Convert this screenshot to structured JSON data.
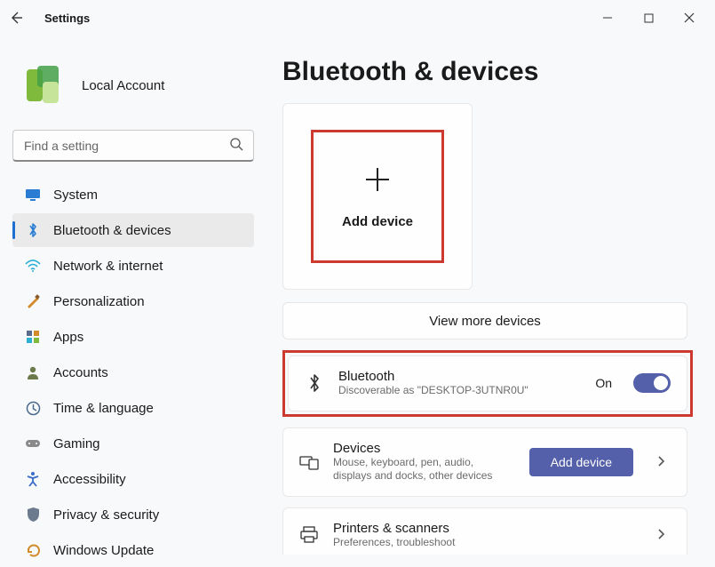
{
  "titlebar": {
    "title": "Settings"
  },
  "profile": {
    "name": "Local Account"
  },
  "search": {
    "placeholder": "Find a setting"
  },
  "sidebar": {
    "items": [
      {
        "label": "System"
      },
      {
        "label": "Bluetooth & devices"
      },
      {
        "label": "Network & internet"
      },
      {
        "label": "Personalization"
      },
      {
        "label": "Apps"
      },
      {
        "label": "Accounts"
      },
      {
        "label": "Time & language"
      },
      {
        "label": "Gaming"
      },
      {
        "label": "Accessibility"
      },
      {
        "label": "Privacy & security"
      },
      {
        "label": "Windows Update"
      }
    ]
  },
  "page": {
    "title": "Bluetooth & devices",
    "add_device_tile": "Add device",
    "view_more": "View more devices",
    "bluetooth_card": {
      "title": "Bluetooth",
      "subtitle": "Discoverable as \"DESKTOP-3UTNR0U\"",
      "state_label": "On"
    },
    "devices_card": {
      "title": "Devices",
      "subtitle": "Mouse, keyboard, pen, audio, displays and docks, other devices",
      "button": "Add device"
    },
    "printers_card": {
      "title": "Printers & scanners",
      "subtitle": "Preferences, troubleshoot"
    }
  }
}
